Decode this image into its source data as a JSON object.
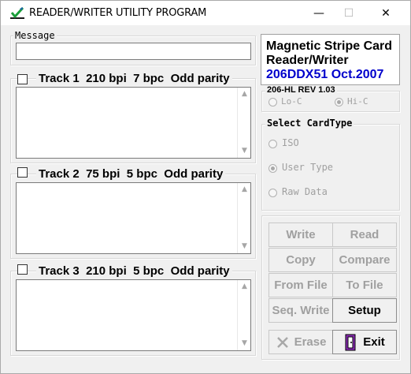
{
  "window": {
    "title": "READER/WRITER UTILITY PROGRAM",
    "minimize_glyph": "—",
    "maximize_glyph": "☐",
    "close_glyph": "✕"
  },
  "message": {
    "label": "Message",
    "value": ""
  },
  "tracks": [
    {
      "label": "Track 1",
      "bpi": "210 bpi",
      "bpc": "7 bpc",
      "parity": "Odd parity",
      "checked": false,
      "value": ""
    },
    {
      "label": "Track 2",
      "bpi": "75 bpi",
      "bpc": "5 bpc",
      "parity": "Odd parity",
      "checked": false,
      "value": ""
    },
    {
      "label": "Track 3",
      "bpi": "210 bpi",
      "bpc": "5 bpc",
      "parity": "Odd parity",
      "checked": false,
      "value": ""
    }
  ],
  "info": {
    "line1": "Magnetic Stripe Card",
    "line2": "Reader/Writer",
    "line3": "206DDX51 Oct.2007"
  },
  "coercivity": {
    "label": "206-HL REV 1.03",
    "options": [
      {
        "label": "Lo-C",
        "checked": false
      },
      {
        "label": "Hi-C",
        "checked": true
      }
    ]
  },
  "card_type": {
    "label": "Select CardType",
    "options": [
      {
        "label": "ISO",
        "checked": false
      },
      {
        "label": "User Type",
        "checked": true
      },
      {
        "label": "Raw Data",
        "checked": false
      }
    ]
  },
  "buttons": {
    "write": "Write",
    "read": "Read",
    "copy": "Copy",
    "compare": "Compare",
    "from_file": "From File",
    "to_file": "To File",
    "seq_write": "Seq. Write",
    "setup": "Setup",
    "erase": "Erase",
    "exit": "Exit"
  },
  "colors": {
    "info_title": "#000000",
    "info_version": "#0000cc",
    "disabled_text": "#a0a0a0",
    "title_icon_green": "#1b9e3a"
  },
  "icons": {
    "app": "checkmark-pen-icon",
    "erase": "x-erase-icon",
    "exit": "door-exit-icon"
  }
}
